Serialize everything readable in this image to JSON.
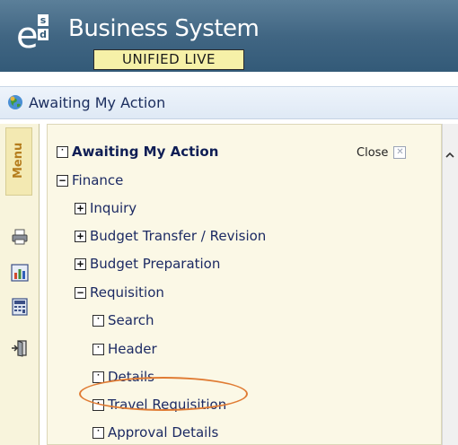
{
  "header": {
    "logo_letters": {
      "main": "e",
      "top": "s",
      "bottom": "d"
    },
    "app_title": "Business System",
    "environment_badge": "UNIFIED LIVE",
    "background_color": "#416683"
  },
  "subheader": {
    "icon": "globe-icon",
    "title": "Awaiting My Action"
  },
  "left_toolbar": {
    "menu_tab_label": "Menu",
    "tools": [
      "printer-icon",
      "chart-icon",
      "calculator-icon",
      "exit-icon"
    ]
  },
  "panel": {
    "close_label": "Close",
    "tree": [
      {
        "label": "Awaiting My Action",
        "level": 0,
        "state": "leaf",
        "bold": true
      },
      {
        "label": "Finance",
        "level": 0,
        "state": "expanded"
      },
      {
        "label": "Inquiry",
        "level": 1,
        "state": "collapsed"
      },
      {
        "label": "Budget Transfer / Revision",
        "level": 1,
        "state": "collapsed"
      },
      {
        "label": "Budget Preparation",
        "level": 1,
        "state": "collapsed"
      },
      {
        "label": "Requisition",
        "level": 1,
        "state": "expanded"
      },
      {
        "label": "Search",
        "level": 2,
        "state": "leaf"
      },
      {
        "label": "Header",
        "level": 2,
        "state": "leaf"
      },
      {
        "label": "Details",
        "level": 2,
        "state": "leaf"
      },
      {
        "label": "Travel Requisition",
        "level": 2,
        "state": "leaf",
        "highlighted": true
      },
      {
        "label": "Approval Details",
        "level": 2,
        "state": "leaf"
      }
    ]
  },
  "colors": {
    "link_text": "#1c2a63",
    "panel_bg": "#fbf8e6",
    "menu_tab_text": "#b57d1d",
    "highlight_oval": "#e07b33"
  }
}
